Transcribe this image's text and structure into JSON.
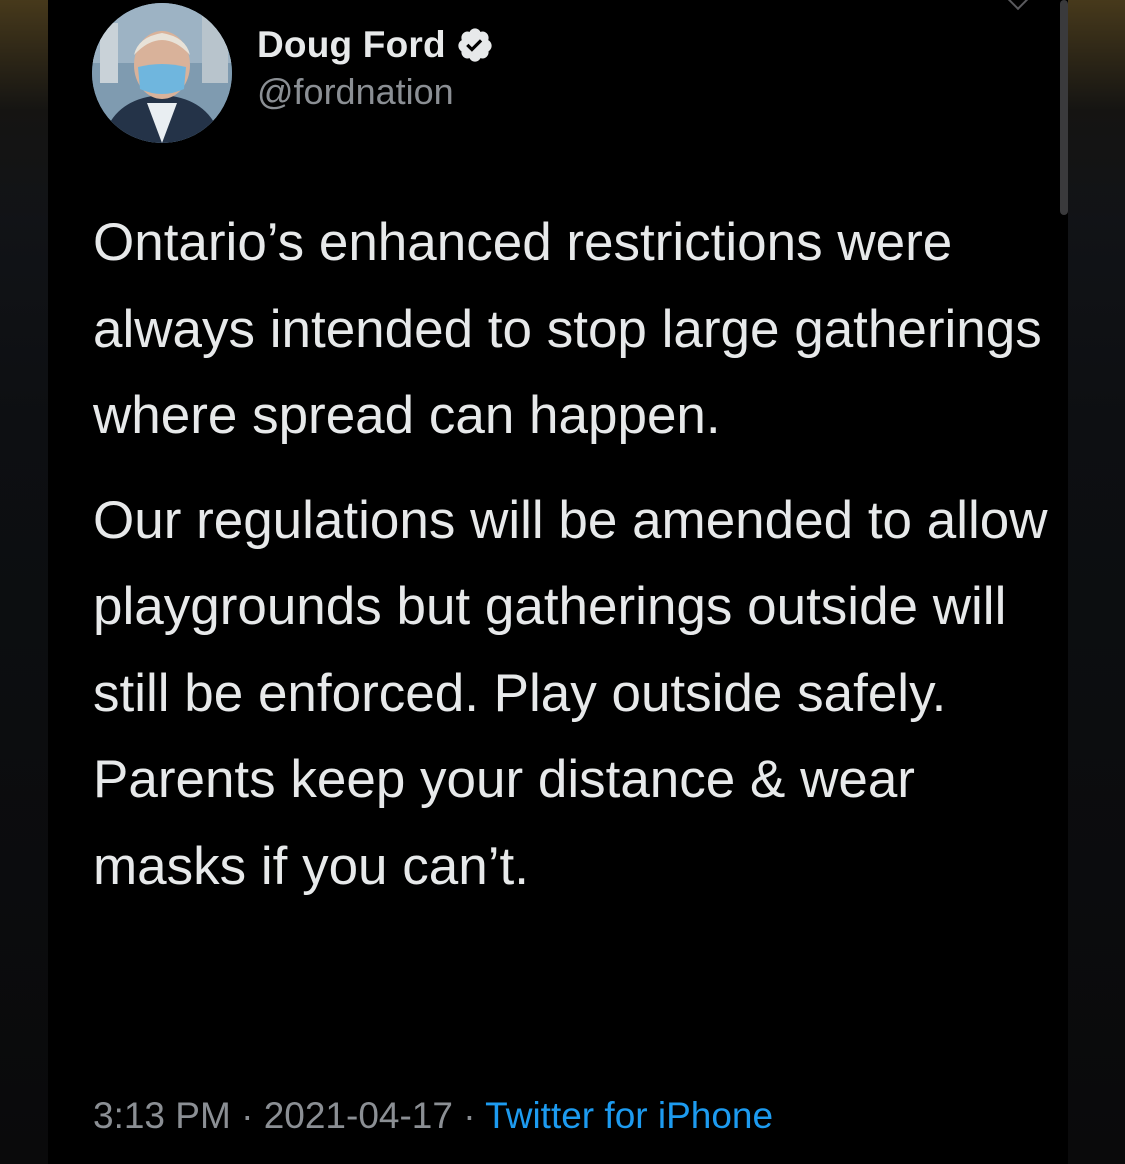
{
  "tweet": {
    "author": {
      "name": "Doug Ford",
      "handle": "@fordnation",
      "verified": true
    },
    "paragraphs": [
      "Ontario’s enhanced restrictions were always intended to stop large gatherings where spread can happen.",
      "Our regulations will be amended to allow playgrounds but gatherings outside will still be enforced. Play outside safely. Parents keep your distance & wear masks if you can’t."
    ],
    "time": "3:13 PM",
    "separator": " · ",
    "date": "2021-04-17",
    "source": "Twitter for iPhone"
  },
  "colors": {
    "background": "#000000",
    "text_primary": "#e7e9ea",
    "text_secondary": "#8b8f94",
    "link": "#1d9bf0"
  },
  "icons": {
    "verified": "verified-badge-icon",
    "avatar": "profile-photo"
  }
}
